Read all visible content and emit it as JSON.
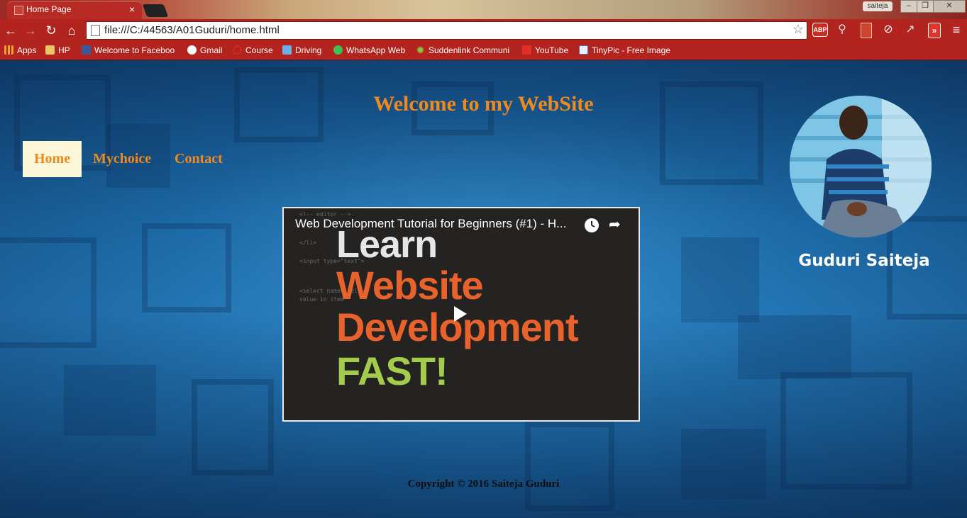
{
  "window": {
    "tab_title": "Home Page",
    "tab_close": "×",
    "profile_name": "saiteja",
    "min_glyph": "–",
    "max_glyph": "❐",
    "close_glyph": "✕"
  },
  "toolbar": {
    "back_glyph": "←",
    "forward_glyph": "→",
    "reload_glyph": "↻",
    "home_glyph": "⌂",
    "url": "file:///C:/44563/A01Guduri/home.html",
    "star_glyph": "☆",
    "abp_label": "ABP",
    "menu_glyph": "≡",
    "extension_icons": [
      "adblock-plus-icon",
      "search-magnifier-icon",
      "bookmark-book-icon",
      "block-icon",
      "external-arrow-icon",
      "forward-icon"
    ]
  },
  "bookmarks": [
    {
      "label": "Apps",
      "icon": "apps-grid-icon",
      "color": "#e8a23a"
    },
    {
      "label": "HP",
      "icon": "folder-icon",
      "color": "#e8c46a"
    },
    {
      "label": "Welcome to Faceboo",
      "icon": "facebook-icon",
      "color": "#3b5998"
    },
    {
      "label": "Gmail",
      "icon": "google-icon",
      "color": "#ffffff"
    },
    {
      "label": "Course",
      "icon": "dotted-circle-icon",
      "color": "#e0332a"
    },
    {
      "label": "Driving",
      "icon": "driving-icon",
      "color": "#6cb0e6"
    },
    {
      "label": "WhatsApp Web",
      "icon": "whatsapp-icon",
      "color": "#3ec24f"
    },
    {
      "label": "Suddenlink Communi",
      "icon": "suddenlink-icon",
      "color": "#8cc63f"
    },
    {
      "label": "YouTube",
      "icon": "youtube-icon",
      "color": "#e52d27"
    },
    {
      "label": "TinyPic - Free Image",
      "icon": "tinypic-icon",
      "color": "#e9eef6"
    }
  ],
  "page": {
    "title": "Welcome to my WebSite",
    "nav": [
      {
        "label": "Home",
        "active": true
      },
      {
        "label": "Mychoice",
        "active": false
      },
      {
        "label": "Contact",
        "active": false
      }
    ],
    "profile_name": "Guduri Saiteja",
    "video": {
      "title": "Web Development Tutorial for Beginners (#1) - H...",
      "line1": "Learn",
      "line2": "Website",
      "line3": "Development",
      "line4": "FAST!"
    },
    "copyright": "Copyright © 2016 Saiteja Guduri"
  },
  "colors": {
    "chrome_red": "#b3241f",
    "accent_orange": "#f08a1f",
    "nav_active_bg": "#fdf7d9"
  }
}
